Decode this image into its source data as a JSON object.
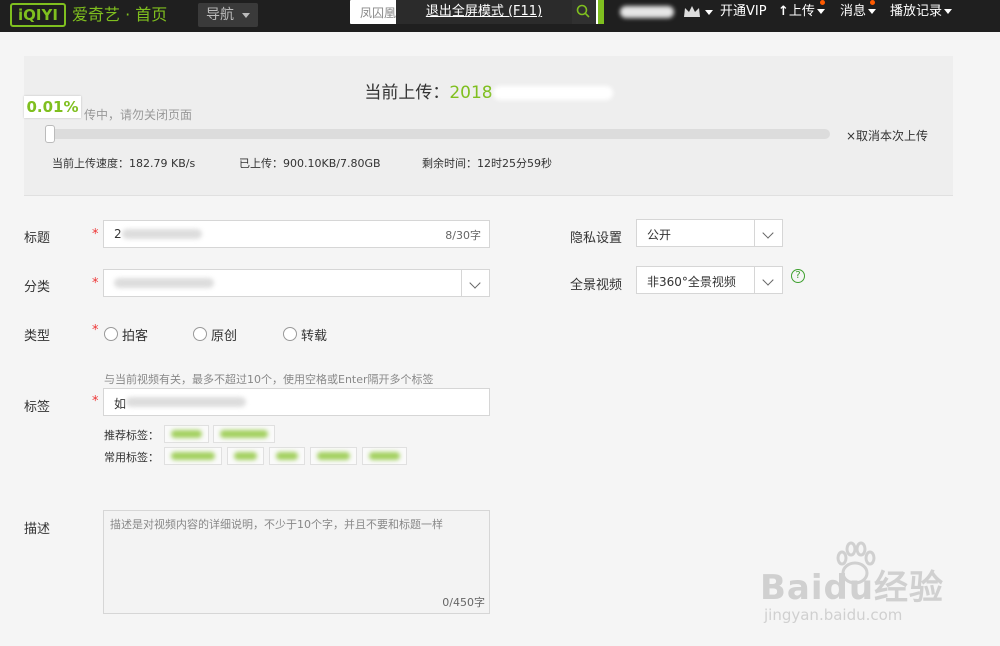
{
  "header": {
    "logo": "iQIYI",
    "brand": "爱奇艺 · 首页",
    "nav_label": "导航",
    "search_placeholder": "凤囚凰",
    "fullscreen_hint": "退出全屏模式 (F11)",
    "vip_label": "开通VIP",
    "upload_label": "上传",
    "messages_label": "消息",
    "history_label": "播放记录"
  },
  "upload": {
    "title_prefix": "当前上传：",
    "title_file_visible": "2018",
    "percent": "0.01%",
    "percent_value": 0.0001,
    "hint": "传中，请勿关闭页面",
    "cancel": "×取消本次上传",
    "speed": "当前上传速度：182.79 KB/s",
    "uploaded": "已上传：900.10KB/7.80GB",
    "remaining": "剩余时间：12时25分59秒"
  },
  "form": {
    "title_label": "标题",
    "title_value": "2",
    "title_count": "8/30字",
    "category_label": "分类",
    "category_value": "",
    "type_label": "类型",
    "type_options": [
      "拍客",
      "原创",
      "转载"
    ],
    "tags_hint": "与当前视频有关，最多不超过10个，使用空格或Enter隔开多个标签",
    "tags_label": "标签",
    "tags_value": "如",
    "recommend_label": "推荐标签：",
    "common_label": "常用标签：",
    "desc_label": "描述",
    "desc_placeholder": "描述是对视频内容的详细说明，不少于10个字，并且不要和标题一样",
    "desc_count": "0/450字",
    "privacy_label": "隐私设置",
    "privacy_value": "公开",
    "pano_label": "全景视频",
    "pano_value": "非360°全景视频",
    "help_symbol": "?",
    "required_mark": "*"
  },
  "watermark": {
    "big": "Baidu经验",
    "small": "jingyan.baidu.com"
  },
  "colors": {
    "accent": "#7fbf1f",
    "topbar": "#1f1f1f",
    "help": "#3fa02f"
  }
}
